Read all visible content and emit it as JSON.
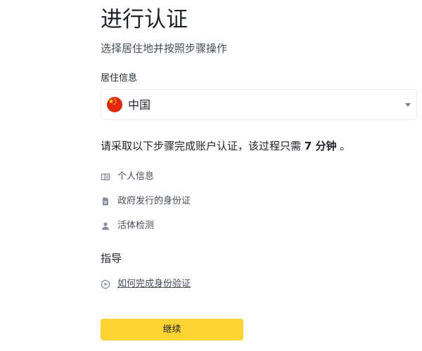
{
  "header": {
    "title": "进行认证",
    "subtitle": "选择居住地并按照步骤操作"
  },
  "residence": {
    "label": "居住信息",
    "selected_value": "中国",
    "flag_icon": "china-flag-icon"
  },
  "intro": {
    "text_before": "请采取以下步骤完成账户认证，该过程只需 ",
    "duration": "7 分钟",
    "text_after": " 。"
  },
  "steps": [
    {
      "label": "个人信息",
      "icon": "id-card-icon"
    },
    {
      "label": "政府发行的身份证",
      "icon": "document-icon"
    },
    {
      "label": "活体检测",
      "icon": "person-icon"
    }
  ],
  "guide": {
    "heading": "指导",
    "link_label": "如何完成身份验证",
    "icon": "play-circle-icon"
  },
  "actions": {
    "continue_label": "继续"
  },
  "colors": {
    "primary_button": "#fcd535",
    "text_primary": "#1e2329",
    "text_secondary": "#474d57",
    "icon_gray": "#848e9c",
    "border": "#eaecef",
    "flag_red": "#de2910",
    "flag_yellow": "#ffde00"
  }
}
